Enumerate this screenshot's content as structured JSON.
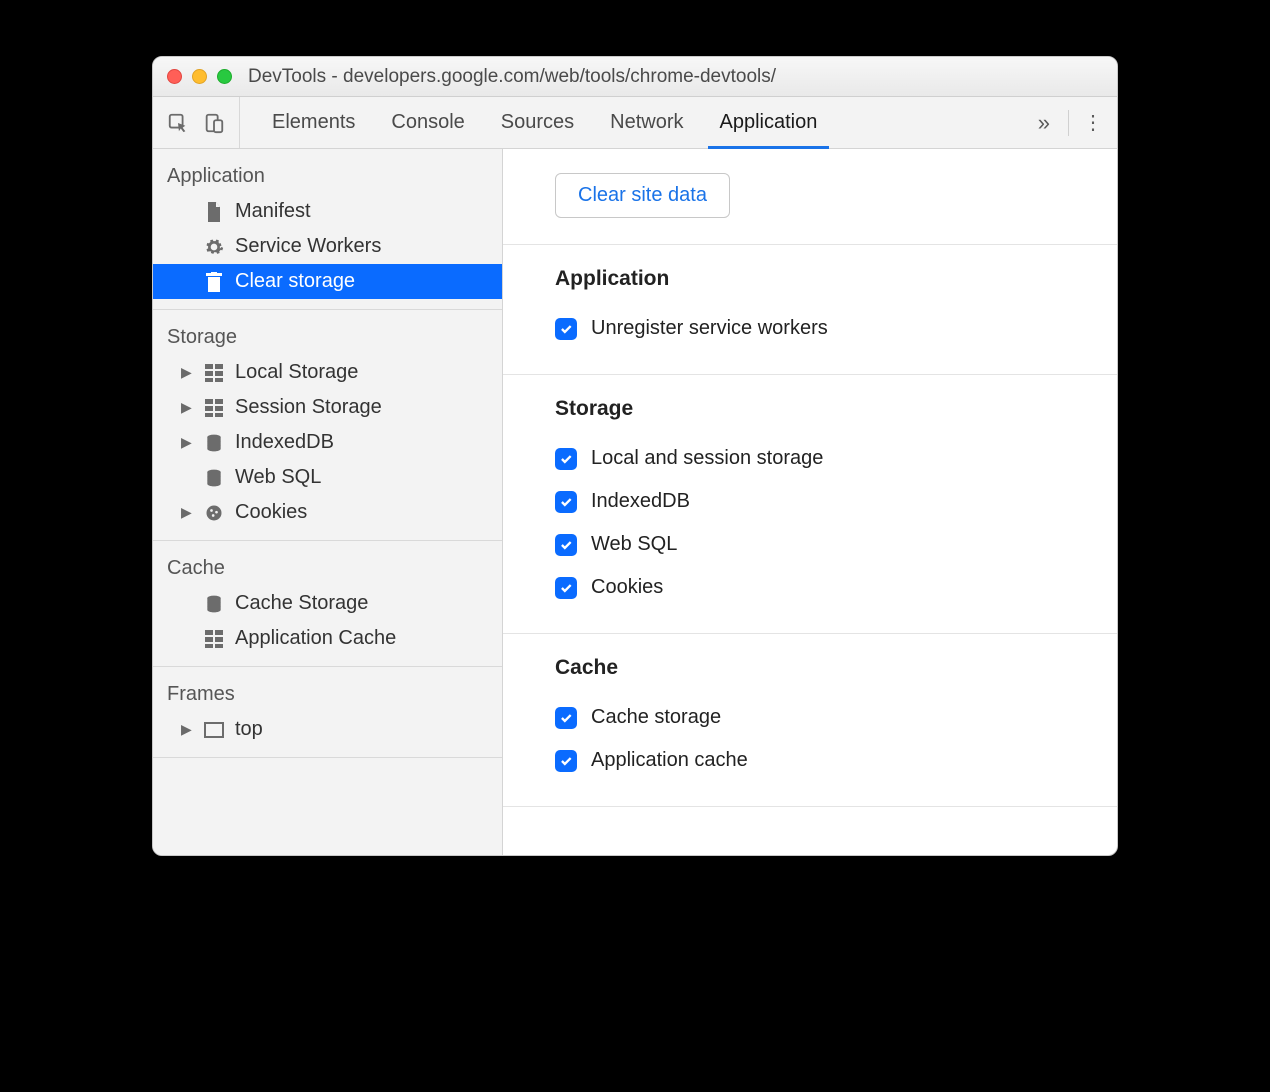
{
  "window": {
    "title": "DevTools - developers.google.com/web/tools/chrome-devtools/"
  },
  "tabs": {
    "items": [
      "Elements",
      "Console",
      "Sources",
      "Network",
      "Application"
    ],
    "active": "Application"
  },
  "sidebar": {
    "sections": [
      {
        "heading": "Application",
        "items": [
          {
            "icon": "file-icon",
            "label": "Manifest",
            "expandable": false
          },
          {
            "icon": "gear-icon",
            "label": "Service Workers",
            "expandable": false
          },
          {
            "icon": "trash-icon",
            "label": "Clear storage",
            "expandable": false,
            "selected": true
          }
        ]
      },
      {
        "heading": "Storage",
        "items": [
          {
            "icon": "grid-icon",
            "label": "Local Storage",
            "expandable": true
          },
          {
            "icon": "grid-icon",
            "label": "Session Storage",
            "expandable": true
          },
          {
            "icon": "db-icon",
            "label": "IndexedDB",
            "expandable": true
          },
          {
            "icon": "db-icon",
            "label": "Web SQL",
            "expandable": false
          },
          {
            "icon": "cookie-icon",
            "label": "Cookies",
            "expandable": true
          }
        ]
      },
      {
        "heading": "Cache",
        "items": [
          {
            "icon": "db-icon",
            "label": "Cache Storage",
            "expandable": false
          },
          {
            "icon": "grid-icon",
            "label": "Application Cache",
            "expandable": false
          }
        ]
      },
      {
        "heading": "Frames",
        "items": [
          {
            "icon": "frame-icon",
            "label": "top",
            "expandable": true
          }
        ]
      }
    ]
  },
  "main": {
    "clear_button": "Clear site data",
    "groups": [
      {
        "heading": "Application",
        "options": [
          {
            "label": "Unregister service workers",
            "checked": true
          }
        ]
      },
      {
        "heading": "Storage",
        "options": [
          {
            "label": "Local and session storage",
            "checked": true
          },
          {
            "label": "IndexedDB",
            "checked": true
          },
          {
            "label": "Web SQL",
            "checked": true
          },
          {
            "label": "Cookies",
            "checked": true
          }
        ]
      },
      {
        "heading": "Cache",
        "options": [
          {
            "label": "Cache storage",
            "checked": true
          },
          {
            "label": "Application cache",
            "checked": true
          }
        ]
      }
    ]
  }
}
